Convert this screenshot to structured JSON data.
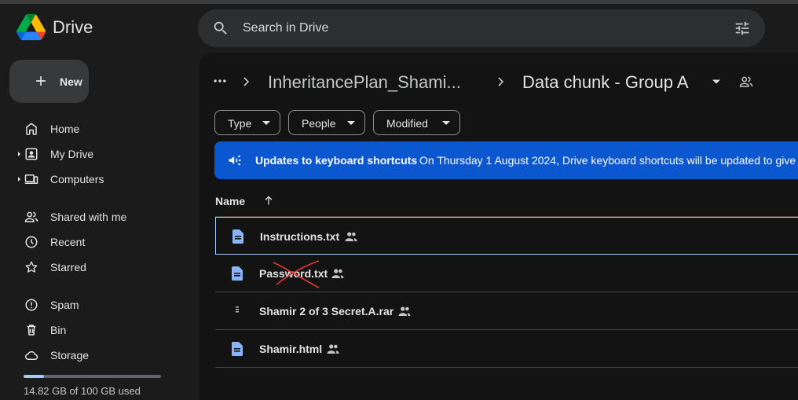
{
  "app": {
    "name": "Drive"
  },
  "search": {
    "placeholder": "Search in Drive"
  },
  "sidebar": {
    "new_label": "New",
    "items": [
      {
        "label": "Home",
        "icon": "home-icon"
      },
      {
        "label": "My Drive",
        "icon": "my-drive-icon"
      },
      {
        "label": "Computers",
        "icon": "computers-icon"
      },
      {
        "label": "Shared with me",
        "icon": "shared-icon"
      },
      {
        "label": "Recent",
        "icon": "clock-icon"
      },
      {
        "label": "Starred",
        "icon": "star-icon"
      },
      {
        "label": "Spam",
        "icon": "spam-icon"
      },
      {
        "label": "Bin",
        "icon": "trash-icon"
      },
      {
        "label": "Storage",
        "icon": "cloud-icon"
      }
    ],
    "storage": {
      "used_text": "14.82 GB of 100 GB used",
      "used_fraction": 0.1482
    }
  },
  "breadcrumb": {
    "parent": "InheritancePlan_Shami...",
    "current": "Data chunk - Group A"
  },
  "filters": {
    "type": "Type",
    "people": "People",
    "modified": "Modified"
  },
  "banner": {
    "title": "Updates to keyboard shortcuts",
    "body": "On Thursday 1 August 2024, Drive keyboard shortcuts will be updated to give"
  },
  "file_list": {
    "column_name": "Name",
    "files": [
      {
        "name": "Instructions.txt",
        "icon": "doc-icon",
        "shared": true,
        "selected": true
      },
      {
        "name": "Password.txt",
        "icon": "doc-icon",
        "shared": true,
        "selected": false
      },
      {
        "name": "Shamir 2 of 3 Secret.A.rar",
        "icon": "archive-icon",
        "shared": true,
        "selected": false
      },
      {
        "name": "Shamir.html",
        "icon": "doc-icon",
        "shared": true,
        "selected": false
      }
    ]
  },
  "colors": {
    "background": "#1b1b1b",
    "content": "#131314",
    "banner": "#0b57d0",
    "accent": "#a8c7fa",
    "doc_icon": "#8ab4f8"
  }
}
